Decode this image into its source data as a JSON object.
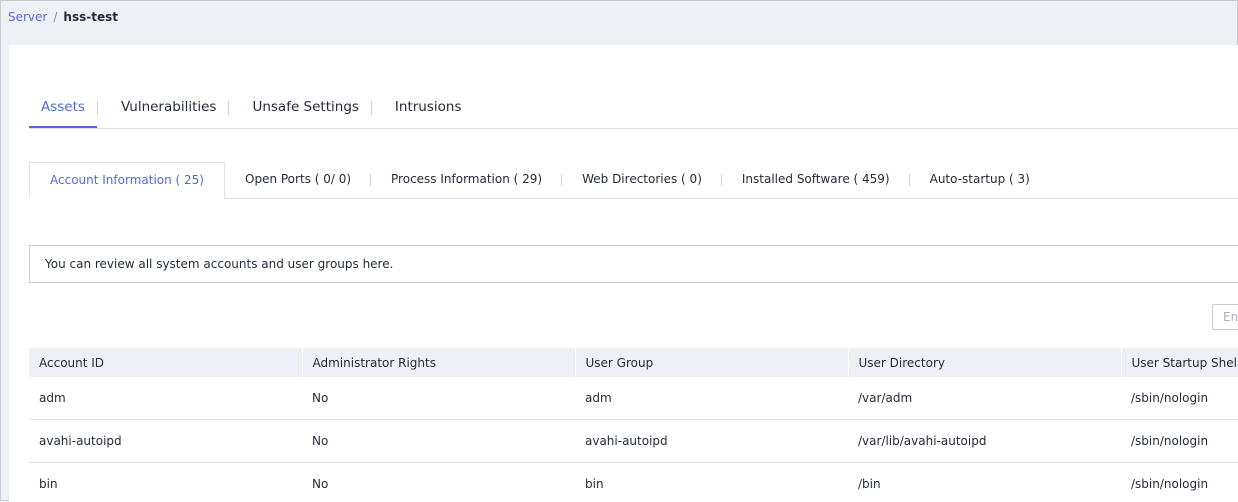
{
  "breadcrumb": {
    "parent": "Server",
    "separator": "/",
    "current": "hss-test"
  },
  "main_tabs": [
    {
      "label": "Assets"
    },
    {
      "label": "Vulnerabilities"
    },
    {
      "label": "Unsafe Settings"
    },
    {
      "label": "Intrusions"
    }
  ],
  "sub_tabs": [
    {
      "label": "Account Information ( 25)"
    },
    {
      "label": "Open Ports ( 0/ 0)"
    },
    {
      "label": "Process Information ( 29)"
    },
    {
      "label": "Web Directories ( 0)"
    },
    {
      "label": "Installed Software ( 459)"
    },
    {
      "label": "Auto-startup ( 3)"
    }
  ],
  "notice": "You can review all system accounts and user groups here.",
  "search": {
    "placeholder": "Ent"
  },
  "table": {
    "columns": [
      "Account ID",
      "Administrator Rights",
      "User Group",
      "User Directory",
      "User Startup Shell"
    ],
    "rows": [
      [
        "adm",
        "No",
        "adm",
        "/var/adm",
        "/sbin/nologin"
      ],
      [
        "avahi-autoipd",
        "No",
        "avahi-autoipd",
        "/var/lib/avahi-autoipd",
        "/sbin/nologin"
      ],
      [
        "bin",
        "No",
        "bin",
        "/bin",
        "/sbin/nologin"
      ]
    ]
  },
  "colors": {
    "accent": "#526ecc",
    "header_bg": "#eef0f5",
    "border": "#dfe1e6"
  }
}
